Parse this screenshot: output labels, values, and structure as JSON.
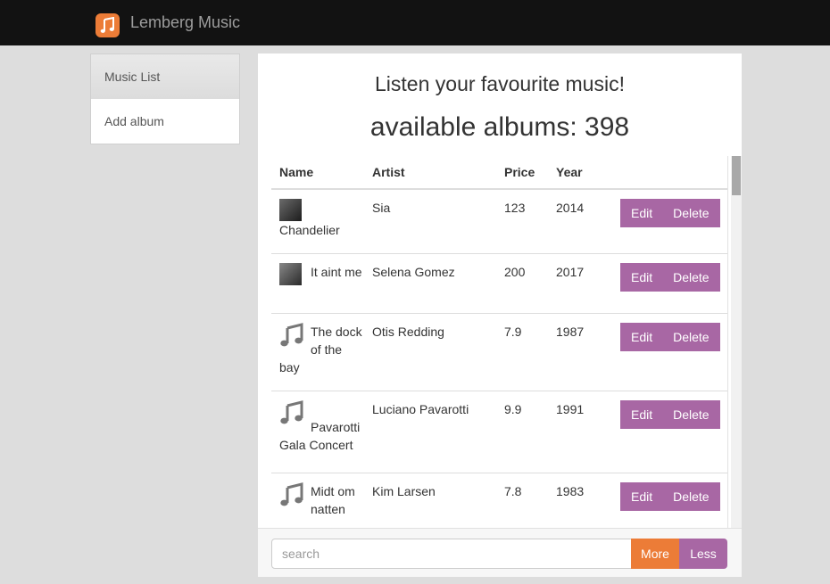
{
  "header": {
    "brand": "Lemberg Music",
    "logo_icon": "music-note-icon",
    "logo_color": "#ec7c37"
  },
  "sidebar": {
    "items": [
      {
        "label": "Music List",
        "active": true
      },
      {
        "label": "Add album",
        "active": false
      }
    ]
  },
  "main": {
    "title": "Listen your favourite music!",
    "count_text": "available albums: 398"
  },
  "table": {
    "columns": [
      "Name",
      "Artist",
      "Price",
      "Year"
    ],
    "rows": [
      {
        "name": "Chandelier",
        "artist": "Sia",
        "price": "123",
        "year": "2014",
        "icon": "album-cover-image"
      },
      {
        "name": "It aint me",
        "artist": "Selena Gomez",
        "price": "200",
        "year": "2017",
        "icon": "album-cover-image"
      },
      {
        "name": "The dock of the bay",
        "artist": "Otis Redding",
        "price": "7.9",
        "year": "1987",
        "icon": "music-note-icon"
      },
      {
        "name": "Pavarotti Gala Concert",
        "artist": "Luciano Pavarotti",
        "price": "9.9",
        "year": "1991",
        "icon": "music-note-icon"
      },
      {
        "name": "Midt om natten",
        "artist": "Kim Larsen",
        "price": "7.8",
        "year": "1983",
        "icon": "music-note-icon"
      }
    ],
    "edit_label": "Edit",
    "delete_label": "Delete"
  },
  "footer": {
    "search_placeholder": "search",
    "more_label": "More",
    "less_label": "Less"
  },
  "colors": {
    "accent_purple": "#a867a4",
    "accent_orange": "#ec7c37",
    "navbar": "#121212"
  }
}
